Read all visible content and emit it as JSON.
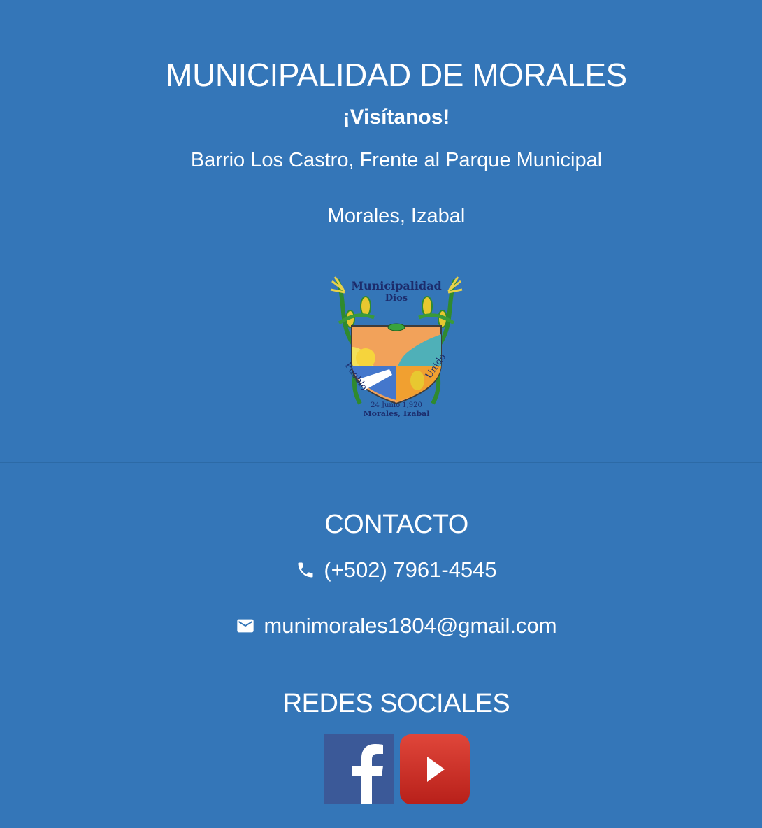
{
  "header": {
    "title": "MUNICIPALIDAD DE MORALES",
    "subtitle": "¡Visítanos!",
    "address_line1": "Barrio Los Castro, Frente al Parque Municipal",
    "address_line2": "Morales, Izabal"
  },
  "crest": {
    "top_text": "Municipalidad",
    "top_text2": "Dios",
    "left_text": "Pueblo",
    "right_text": "Unido",
    "date_text": "24 Junio 1,920",
    "bottom_text": "Morales, Izabal"
  },
  "contact": {
    "title": "CONTACTO",
    "phone": "(+502) 7961-4545",
    "phone_icon": "phone-icon",
    "email": "munimorales1804@gmail.com",
    "email_icon": "email-icon"
  },
  "social": {
    "title": "REDES SOCIALES",
    "items": [
      {
        "name": "facebook",
        "icon": "facebook-icon",
        "color": "#3b5998"
      },
      {
        "name": "youtube",
        "icon": "youtube-icon",
        "color": "#d42d22"
      }
    ]
  },
  "colors": {
    "background": "#3476b8",
    "text": "#ffffff"
  }
}
